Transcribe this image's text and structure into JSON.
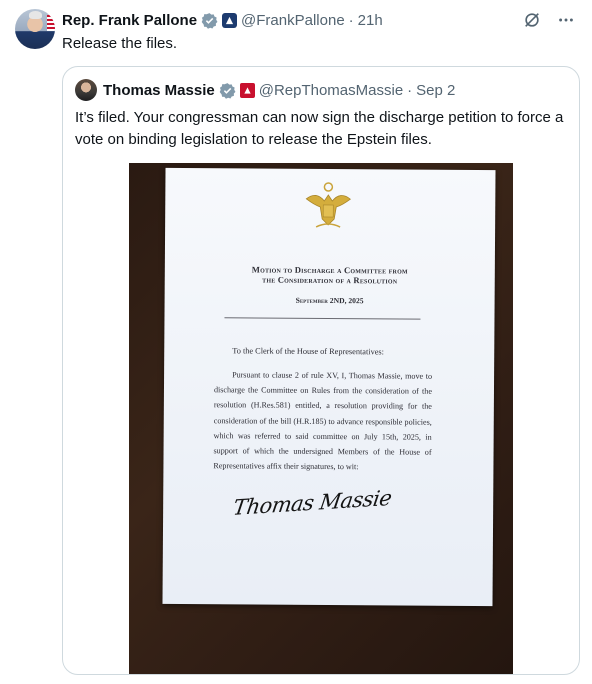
{
  "tweet": {
    "author_name": "Rep. Frank Pallone",
    "handle": "@FrankPallone",
    "time": "21h",
    "text": "Release the files."
  },
  "quoted": {
    "author_name": "Thomas Massie",
    "handle": "@RepThomasMassie",
    "date": "Sep 2",
    "text": "It’s filed. Your congressman can now sign the discharge petition to force a vote on binding legislation to release the Epstein files."
  },
  "document": {
    "title_line1": "Motion to Discharge a Committee from",
    "title_line2": "the Consideration of a Resolution",
    "date": "September 2ND, 2025",
    "salutation": "To the Clerk of the House of Representatives:",
    "body": "Pursuant to clause 2 of rule XV, I, Thomas Massie, move to discharge the Committee on Rules from the consideration of the resolution (H.Res.581) entitled, a resolution providing for the consideration of the bill (H.R.185) to advance responsible policies, which was referred to said committee on July 15th, 2025, in support of which the undersigned Members of the House of Representatives affix their signatures, to wit:",
    "signature": "Thomas Massie"
  },
  "icons": {
    "verified": "verified-badge-icon",
    "government": "government-badge-icon",
    "grok": "grok-icon",
    "more": "more-icon"
  },
  "colors": {
    "verified_blue": "#829aab",
    "text": "#0f1419",
    "muted": "#536471",
    "border": "#cfd9de"
  }
}
